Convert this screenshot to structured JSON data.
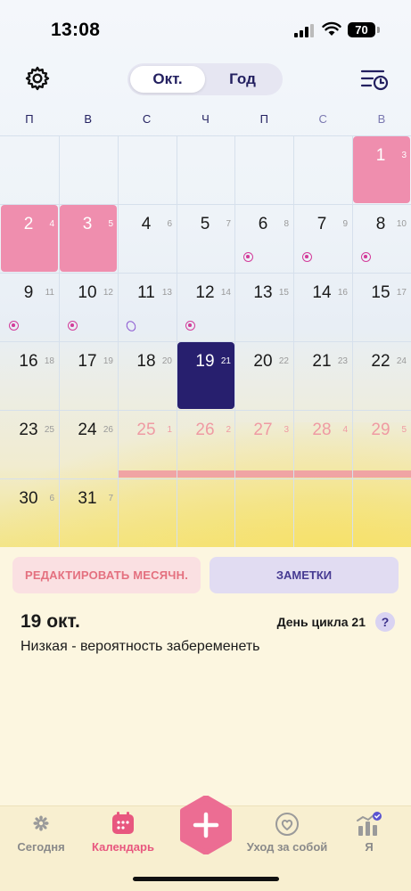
{
  "status": {
    "time": "13:08",
    "battery": "70"
  },
  "header": {
    "segment_month": "Окт.",
    "segment_year": "Год"
  },
  "weekdays": [
    "П",
    "В",
    "С",
    "Ч",
    "П",
    "С",
    "В"
  ],
  "calendar": {
    "cells": [
      {
        "day": "1",
        "cycle": "3",
        "state": "period"
      },
      {
        "day": "2",
        "cycle": "4",
        "state": "period"
      },
      {
        "day": "3",
        "cycle": "5",
        "state": "period"
      },
      {
        "day": "4",
        "cycle": "6",
        "state": "normal"
      },
      {
        "day": "5",
        "cycle": "7",
        "state": "normal"
      },
      {
        "day": "6",
        "cycle": "8",
        "state": "normal",
        "marker": "fertile"
      },
      {
        "day": "7",
        "cycle": "9",
        "state": "normal",
        "marker": "fertile"
      },
      {
        "day": "8",
        "cycle": "10",
        "state": "normal",
        "marker": "fertile"
      },
      {
        "day": "9",
        "cycle": "11",
        "state": "normal",
        "marker": "fertile"
      },
      {
        "day": "10",
        "cycle": "12",
        "state": "normal",
        "marker": "fertile"
      },
      {
        "day": "11",
        "cycle": "13",
        "state": "normal",
        "marker": "ovulation"
      },
      {
        "day": "12",
        "cycle": "14",
        "state": "normal",
        "marker": "fertile"
      },
      {
        "day": "13",
        "cycle": "15",
        "state": "normal"
      },
      {
        "day": "14",
        "cycle": "16",
        "state": "normal"
      },
      {
        "day": "15",
        "cycle": "17",
        "state": "normal"
      },
      {
        "day": "16",
        "cycle": "18",
        "state": "normal"
      },
      {
        "day": "17",
        "cycle": "19",
        "state": "normal"
      },
      {
        "day": "18",
        "cycle": "20",
        "state": "normal"
      },
      {
        "day": "19",
        "cycle": "21",
        "state": "today"
      },
      {
        "day": "20",
        "cycle": "22",
        "state": "normal"
      },
      {
        "day": "21",
        "cycle": "23",
        "state": "normal"
      },
      {
        "day": "22",
        "cycle": "24",
        "state": "normal"
      },
      {
        "day": "23",
        "cycle": "25",
        "state": "normal"
      },
      {
        "day": "24",
        "cycle": "26",
        "state": "normal"
      },
      {
        "day": "25",
        "cycle": "1",
        "state": "predicted"
      },
      {
        "day": "26",
        "cycle": "2",
        "state": "predicted"
      },
      {
        "day": "27",
        "cycle": "3",
        "state": "predicted"
      },
      {
        "day": "28",
        "cycle": "4",
        "state": "predicted"
      },
      {
        "day": "29",
        "cycle": "5",
        "state": "predicted"
      },
      {
        "day": "30",
        "cycle": "6",
        "state": "normal"
      },
      {
        "day": "31",
        "cycle": "7",
        "state": "normal"
      }
    ],
    "colors": {
      "period": "#ef8eae",
      "today": "#271f6e",
      "predicted": "#ef9aa3",
      "fertile_marker": "#d33c9a"
    }
  },
  "actions": {
    "edit_label": "РЕДАКТИРОВАТЬ МЕСЯЧН.",
    "notes_label": "ЗАМЕТКИ"
  },
  "selected_day": {
    "title": "19 окт.",
    "cycle_day": "День цикла 21",
    "help": "?",
    "description": "Низкая - вероятность забеременеть"
  },
  "tabbar": {
    "today": "Сегодня",
    "calendar": "Календарь",
    "selfcare": "Уход за собой",
    "me": "Я"
  }
}
